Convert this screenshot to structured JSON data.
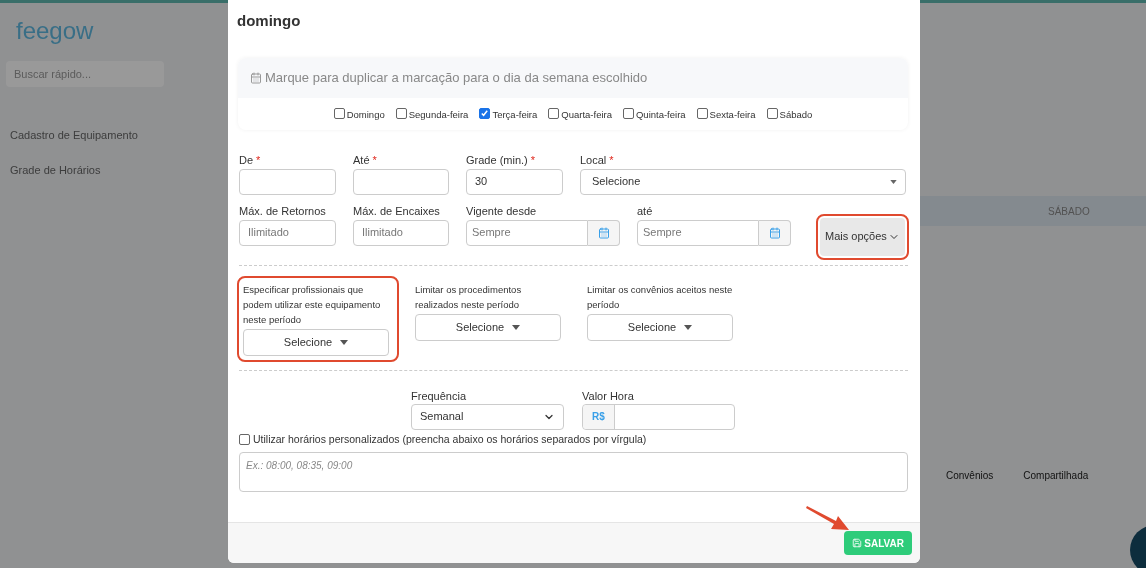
{
  "background": {
    "logo": "feegow",
    "search_placeholder": "Buscar rápido...",
    "sidebar_items": [
      "Cadastro de Equipamento",
      "Grade de Horários"
    ],
    "day_header": "SÁBADO",
    "table_headers": [
      "Convênios",
      "Compartilhada"
    ]
  },
  "modal": {
    "title": "domingo",
    "duplicate_panel": {
      "heading": "Marque para duplicar a marcação para o dia da semana escolhido",
      "days": [
        {
          "label": "Domingo",
          "checked": false
        },
        {
          "label": "Segunda-feira",
          "checked": false
        },
        {
          "label": "Terça-feira",
          "checked": true
        },
        {
          "label": "Quarta-feira",
          "checked": false
        },
        {
          "label": "Quinta-feira",
          "checked": false
        },
        {
          "label": "Sexta-feira",
          "checked": false
        },
        {
          "label": "Sábado",
          "checked": false
        }
      ]
    },
    "row1": [
      {
        "kind": "text",
        "label": "De",
        "required_mark": "*"
      },
      {
        "kind": "text",
        "label": "Até",
        "required_mark": "*"
      },
      {
        "kind": "text",
        "label": "Grade (min.)",
        "required_mark": "*",
        "value": "30"
      },
      {
        "kind": "select",
        "label": "Local",
        "required_mark": "*",
        "value": "Selecione"
      }
    ],
    "row2": [
      {
        "kind": "text",
        "label": "Máx. de Retornos",
        "placeholder": "Ilimitado"
      },
      {
        "kind": "text",
        "label": "Máx. de Encaixes",
        "placeholder": "Ilimitado"
      },
      {
        "kind": "date",
        "label": "Vigente desde",
        "placeholder": "Sempre"
      },
      {
        "kind": "date",
        "label": "até",
        "placeholder": "Sempre"
      }
    ],
    "more_button": {
      "label": "Mais opções",
      "highlighted": true
    },
    "restrictions": [
      {
        "label": "Especificar profissionais que podem utilizar este equipamento neste período",
        "button": "Selecione",
        "highlighted": true
      },
      {
        "label": "Limitar os procedimentos realizados neste período",
        "button": "Selecione",
        "highlighted": false
      },
      {
        "label": "Limitar os convênios aceitos neste período",
        "button": "Selecione",
        "highlighted": false
      }
    ],
    "frequency": {
      "label": "Frequência",
      "value": "Semanal"
    },
    "hourly_value": {
      "label": "Valor Hora",
      "prefix": "R$"
    },
    "custom_times": {
      "label": "Utilizar horários personalizados (preencha abaixo os horários separados por vírgula)",
      "checked": false,
      "placeholder": "Ex.: 08:00, 08:35, 09:00"
    },
    "save_button": {
      "label": "SALVAR"
    }
  }
}
